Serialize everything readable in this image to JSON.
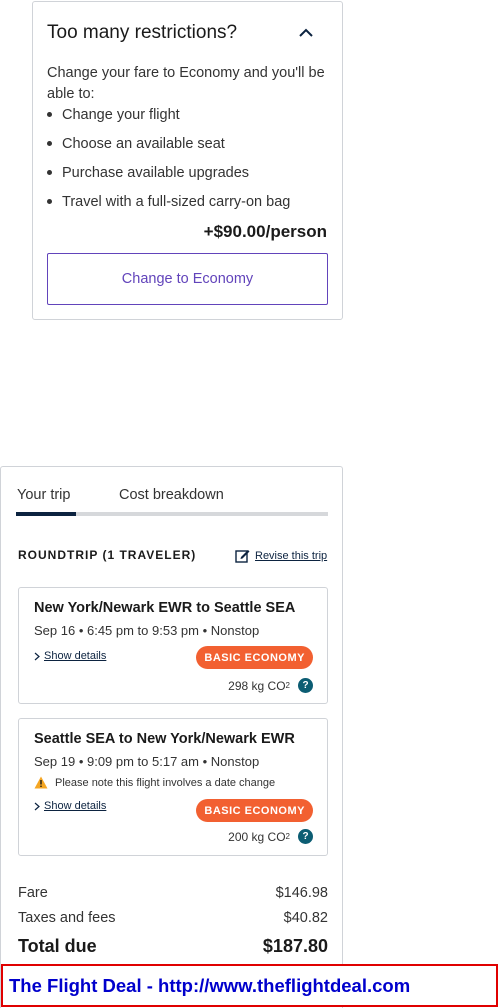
{
  "restrictions": {
    "title": "Too many restrictions?",
    "intro": "Change your fare to Economy and you'll be able to:",
    "benefits": [
      "Change your flight",
      "Choose an available seat",
      "Purchase available upgrades",
      "Travel with a full-sized carry-on bag"
    ],
    "price": "+$90.00/person",
    "button_label": "Change to Economy"
  },
  "trip": {
    "tabs": [
      "Your trip",
      "Cost breakdown"
    ],
    "roundtrip_label": "ROUNDTRIP (1 TRAVELER)",
    "revise_label": "Revise this trip",
    "flights": [
      {
        "route": "New York/Newark EWR to Seattle SEA",
        "schedule": "Sep 16 • 6:45 pm to 9:53 pm • Nonstop",
        "details_label": "Show details",
        "badge": "BASIC ECONOMY",
        "co2_value": "298 kg CO",
        "co2_sub": "2"
      },
      {
        "route": "Seattle SEA to New York/Newark EWR",
        "schedule": "Sep 19 • 9:09 pm to 5:17 am • Nonstop",
        "note": "Please note this flight involves a date change",
        "details_label": "Show details",
        "badge": "BASIC ECONOMY",
        "co2_value": "200 kg CO",
        "co2_sub": "2"
      }
    ],
    "costs": {
      "fare_label": "Fare",
      "fare_value": "$146.98",
      "taxes_label": "Taxes and fees",
      "taxes_value": "$40.82",
      "total_label": "Total due",
      "total_value": "$187.80"
    }
  },
  "banner": {
    "text": "The Flight Deal - http://www.theflightdeal.com"
  },
  "colors": {
    "accent_purple": "#6244bb",
    "navy": "#0c2340",
    "badge_orange": "#f26031",
    "banner_border": "#e00000",
    "banner_text": "#0000cc"
  }
}
